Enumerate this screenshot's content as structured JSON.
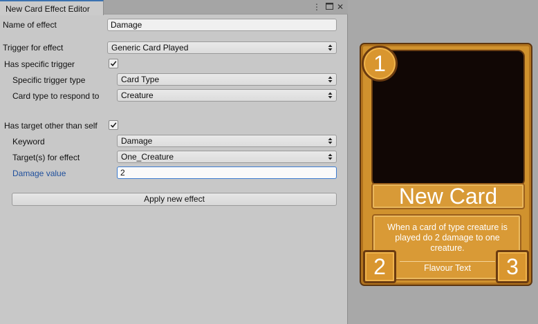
{
  "window": {
    "tab_title": "New Card Effect Editor",
    "controls": {
      "menu_icon": "kebab-menu-icon",
      "maximize_icon": "maximize-icon",
      "close_icon": "close-icon"
    }
  },
  "form": {
    "name_of_effect": {
      "label": "Name of effect",
      "value": "Damage"
    },
    "trigger_for_effect": {
      "label": "Trigger for effect",
      "value": "Generic Card Played"
    },
    "has_specific_trigger": {
      "label": "Has specific trigger",
      "checked": true
    },
    "specific_trigger_type": {
      "label": "Specific trigger type",
      "value": "Card Type"
    },
    "card_type_to_respond_to": {
      "label": "Card type to respond to",
      "value": "Creature"
    },
    "has_target_other_than_self": {
      "label": "Has target other than self",
      "checked": true
    },
    "keyword": {
      "label": "Keyword",
      "value": "Damage"
    },
    "targets_for_effect": {
      "label": "Target(s) for effect",
      "value": "One_Creature"
    },
    "damage_value": {
      "label": "Damage value",
      "value": "2"
    },
    "apply_button": "Apply new effect"
  },
  "card": {
    "cost": "1",
    "name": "New Card",
    "description": "When a card of type creature is played do 2 damage to one creature.",
    "flavour_text": "Flavour Text",
    "attack": "2",
    "health": "3"
  },
  "colors": {
    "editor_bg": "#c8c8c8",
    "tab_accent": "#3a72b0",
    "focus_blue": "#3b7bd0",
    "card_gold": "#d0922e",
    "card_border": "#5c3510"
  }
}
